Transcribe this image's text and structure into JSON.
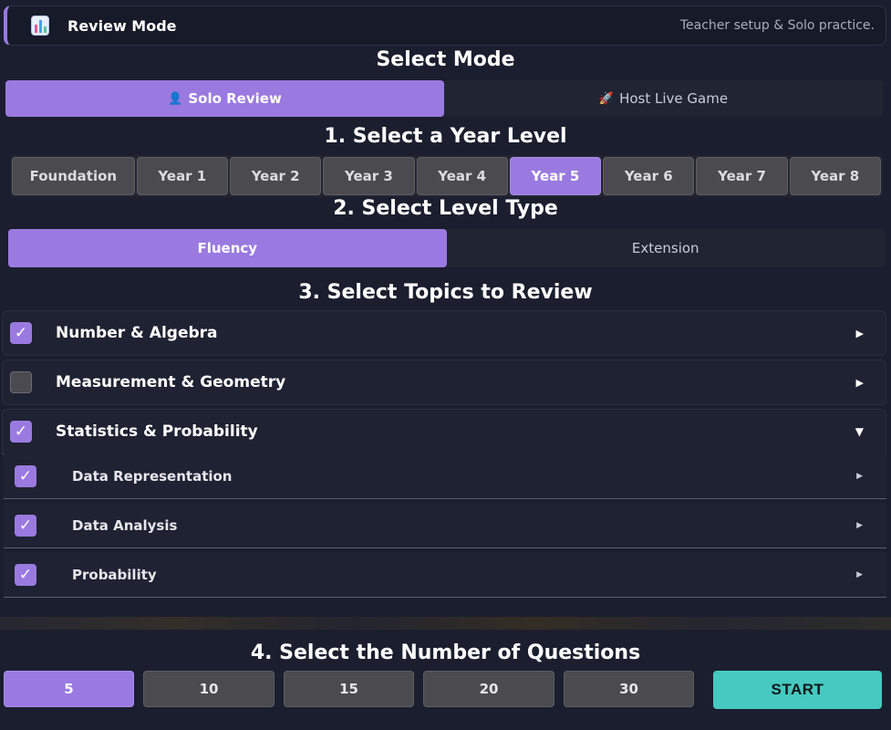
{
  "header": {
    "title": "Review Mode",
    "subtitle": "Teacher setup & Solo practice."
  },
  "mode": {
    "title": "Select Mode",
    "options": [
      {
        "label": "Solo Review",
        "icon": "person-icon",
        "active": true
      },
      {
        "label": "Host Live Game",
        "icon": "rocket-icon",
        "active": false
      }
    ]
  },
  "year_level": {
    "title": "1. Select a Year Level",
    "options": [
      "Foundation",
      "Year 1",
      "Year 2",
      "Year 3",
      "Year 4",
      "Year 5",
      "Year 6",
      "Year 7",
      "Year 8"
    ],
    "selected": "Year 5"
  },
  "level_type": {
    "title": "2. Select Level Type",
    "options": [
      "Fluency",
      "Extension"
    ],
    "selected": "Fluency"
  },
  "topics": {
    "title": "3. Select Topics to Review",
    "items": [
      {
        "label": "Number & Algebra",
        "checked": true,
        "expanded": false
      },
      {
        "label": "Measurement & Geometry",
        "checked": false,
        "expanded": false
      },
      {
        "label": "Statistics & Probability",
        "checked": true,
        "expanded": true,
        "subtopics": [
          {
            "label": "Data Representation",
            "checked": true
          },
          {
            "label": "Data Analysis",
            "checked": true
          },
          {
            "label": "Probability",
            "checked": true
          }
        ]
      }
    ]
  },
  "questions": {
    "title": "4. Select the Number of Questions",
    "options": [
      "5",
      "10",
      "15",
      "20",
      "30"
    ],
    "selected": "5",
    "start_label": "START"
  },
  "colors": {
    "accent": "#9a7ae0",
    "start": "#45c9c0",
    "background": "#1b1e2e"
  }
}
